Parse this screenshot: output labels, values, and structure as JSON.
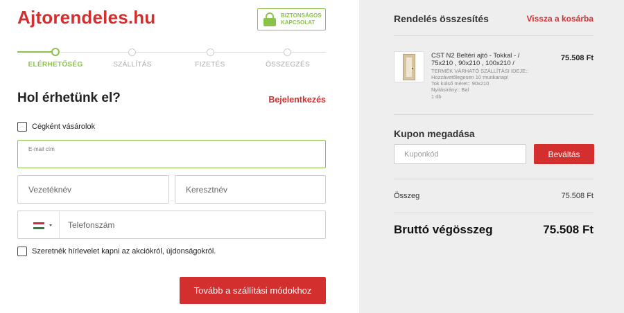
{
  "brand": {
    "logo": "Ajtorendeles.hu",
    "secure_line1": "Biztonságos",
    "secure_line2": "kapcsolat"
  },
  "steps": [
    {
      "label": "Elérhetőség",
      "active": true
    },
    {
      "label": "Szállítás",
      "active": false
    },
    {
      "label": "Fizetés",
      "active": false
    },
    {
      "label": "Összegzés",
      "active": false
    }
  ],
  "form": {
    "title": "Hol érhetünk el?",
    "login_link": "Bejelentkezés",
    "company_checkbox": "Cégként vásárolok",
    "email_label": "E-mail cím",
    "email_value": "",
    "lastname_placeholder": "Vezetéknév",
    "firstname_placeholder": "Keresztnév",
    "phone_placeholder": "Telefonszám",
    "phone_country": "HU",
    "newsletter_checkbox": "Szeretnék hírlevelet kapni az akciókról, újdonságokról.",
    "submit_label": "Tovább a szállítási módokhoz"
  },
  "summary": {
    "title": "Rendelés összesítés",
    "back_link": "Vissza a kosárba",
    "item": {
      "name": "CST N2 Beltéri ajtó - Tokkal - / 75x210 , 90x210 , 100x210 /",
      "meta_line1": "TERMÉK VÁRHATÓ SZÁLLÍTÁSI IDEJE::",
      "meta_line2": "Hozzávetőlegesen 10 munkanap!",
      "meta_line3": "Tok külső méret:: 90x210",
      "meta_line4": "Nyitásirány:: Bal",
      "qty": "1 db",
      "price": "75.508 Ft"
    },
    "coupon_title": "Kupon megadása",
    "coupon_placeholder": "Kuponkód",
    "coupon_button": "Beváltás",
    "subtotal_label": "Összeg",
    "subtotal_value": "75.508 Ft",
    "total_label": "Bruttó végösszeg",
    "total_value": "75.508 Ft"
  },
  "colors": {
    "accent": "#d32f2f",
    "green": "#8bc34a",
    "panel": "#eeeeee"
  }
}
